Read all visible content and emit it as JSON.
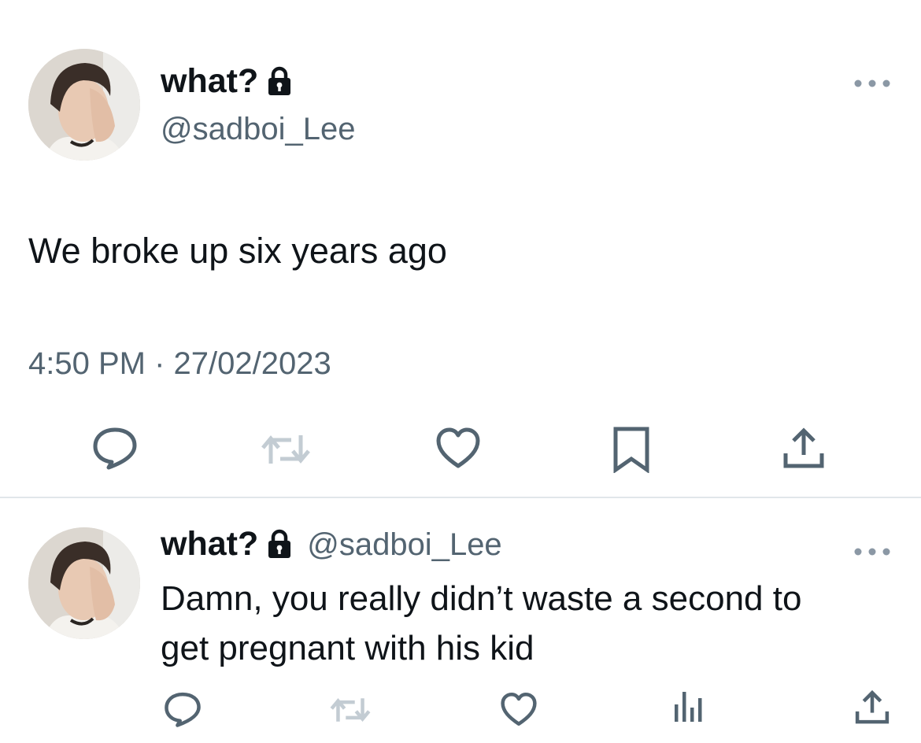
{
  "main_tweet": {
    "author_name": "what?",
    "author_handle": "@sadboi_Lee",
    "text": "We broke up six years ago",
    "timestamp": "4:50 PM · 27/02/2023",
    "actions": [
      "reply-icon",
      "retweet-icon",
      "like-icon",
      "bookmark-icon",
      "share-icon"
    ],
    "more_label": "•••"
  },
  "reply_tweet": {
    "author_name": "what?",
    "author_handle": "@sadboi_Lee",
    "text_line1": "Damn, you really didn’t waste a second to",
    "text_line2": "get pregnant with his kid",
    "actions": [
      "reply-icon",
      "retweet-icon",
      "like-icon",
      "views-icon",
      "share-icon"
    ],
    "more_label": "•••"
  },
  "colors": {
    "text_primary": "#0f1419",
    "text_secondary": "#536471",
    "icon": "#536471",
    "icon_disabled": "#c3ccd3",
    "divider": "#e1e6ea"
  }
}
